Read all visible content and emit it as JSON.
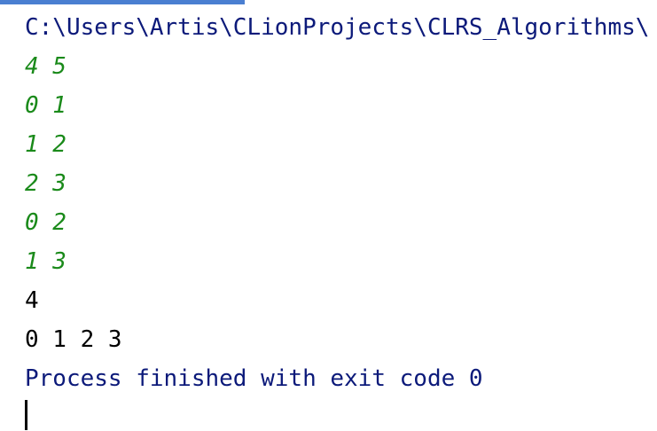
{
  "console": {
    "path_line": "C:\\Users\\Artis\\CLionProjects\\CLRS_Algorithms\\",
    "input_lines": [
      "4 5",
      "0 1",
      "1 2",
      "2 3",
      "0 2",
      "1 3"
    ],
    "output_lines": [
      "4",
      "0 1 2 3"
    ],
    "status_line": "Process finished with exit code 0"
  },
  "colors": {
    "path": "#0c1a7a",
    "input": "#1a8a1a",
    "output": "#000000",
    "status": "#0c1a7a",
    "tab_indicator": "#4a7fd1"
  }
}
